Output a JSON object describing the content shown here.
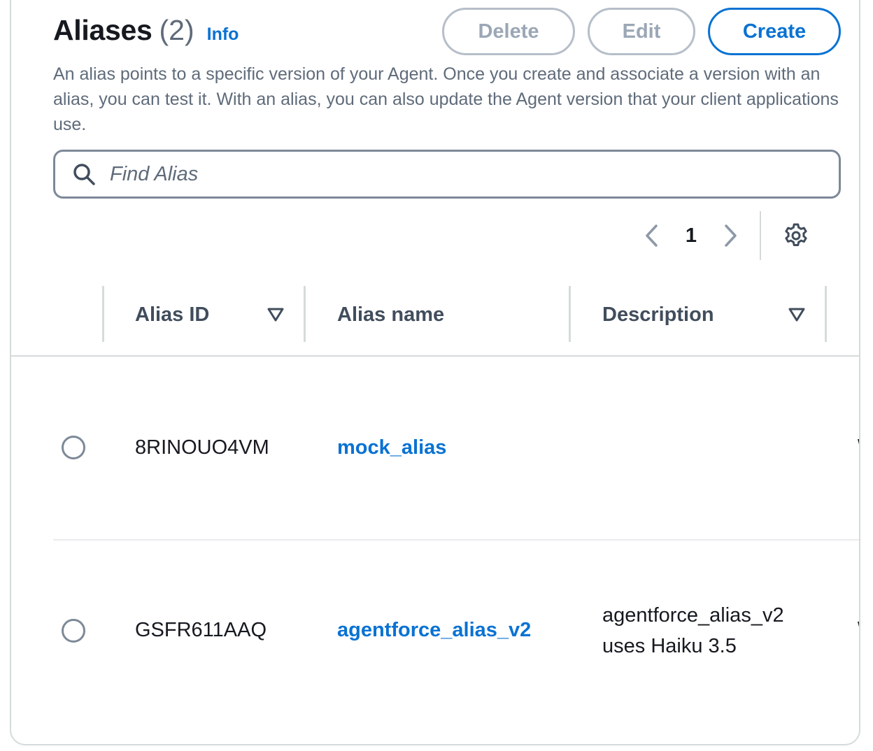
{
  "header": {
    "title": "Aliases",
    "count": "(2)",
    "info_label": "Info",
    "delete_label": "Delete",
    "edit_label": "Edit",
    "create_label": "Create",
    "description": "An alias points to a specific version of your Agent. Once you create and associate a version with an alias, you can test it. With an alias, you can also update the Agent version that your client applications use."
  },
  "search": {
    "placeholder": "Find Alias",
    "value": ""
  },
  "pagination": {
    "current_page": "1"
  },
  "table": {
    "columns": [
      "Alias ID",
      "Alias name",
      "Description"
    ],
    "rows": [
      {
        "alias_id": "8RINOUO4VM",
        "alias_name": "mock_alias",
        "description": ""
      },
      {
        "alias_id": "GSFR611AAQ",
        "alias_name": "agentforce_alias_v2",
        "description_line1": "agentforce_alias_v2",
        "description_line2": "uses Haiku 3.5"
      }
    ]
  },
  "colors": {
    "accent": "#0972d3",
    "disabled_text": "#9ba7b6",
    "border": "#d5dbdb",
    "muted_text": "#5f6b7a"
  },
  "icons": {
    "search": "search-icon",
    "prev": "chevron-left-icon",
    "next": "chevron-right-icon",
    "settings": "gear-icon",
    "sort": "caret-down-icon"
  }
}
